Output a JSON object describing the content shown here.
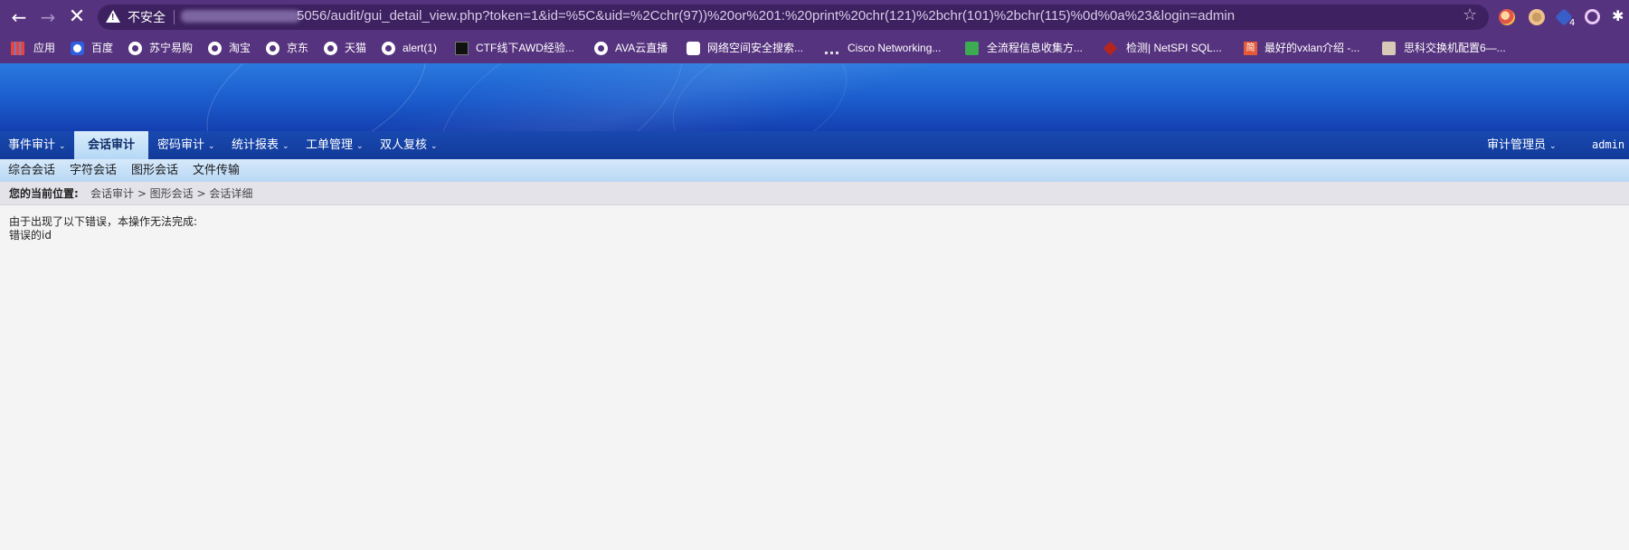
{
  "browser": {
    "back_icon": "arrow-left-icon",
    "forward_icon": "arrow-right-icon",
    "stop_icon": "close-icon",
    "security_label": "不安全",
    "url_visible": "5056/audit/gui_detail_view.php?token=1&id=%5C&uid=%2Cchr(97))%20or%201:%20print%20chr(121)%2bchr(101)%2bchr(115)%0d%0a%23&login=admin",
    "extension_badge": "4"
  },
  "bookmarks": [
    {
      "label": "应用",
      "icon": "apps-grid-icon"
    },
    {
      "label": "百度",
      "icon": "baidu-icon"
    },
    {
      "label": "苏宁易购",
      "icon": "globe-icon"
    },
    {
      "label": "淘宝",
      "icon": "globe-icon"
    },
    {
      "label": "京东",
      "icon": "globe-icon"
    },
    {
      "label": "天猫",
      "icon": "globe-icon"
    },
    {
      "label": "alert(1)",
      "icon": "globe-icon"
    },
    {
      "label": "CTF线下AWD经验...",
      "icon": "ctf-icon"
    },
    {
      "label": "AVA云直播",
      "icon": "globe-icon"
    },
    {
      "label": "网络空间安全搜索...",
      "icon": "fofa-icon"
    },
    {
      "label": "Cisco Networking...",
      "icon": "cisco-icon"
    },
    {
      "label": "全流程信息收集方...",
      "icon": "green-doc-icon"
    },
    {
      "label": "检测| NetSPI SQL...",
      "icon": "netspi-icon"
    },
    {
      "label": "最好的vxlan介绍 -...",
      "icon": "jianshu-icon"
    },
    {
      "label": "思科交换机配置6—...",
      "icon": "photo-icon"
    }
  ],
  "main_menu": [
    {
      "label": "事件审计"
    },
    {
      "label": "会话审计"
    },
    {
      "label": "密码审计"
    },
    {
      "label": "统计报表"
    },
    {
      "label": "工单管理"
    },
    {
      "label": "双人复核"
    }
  ],
  "user_menu": {
    "role": "审计管理员",
    "user": "admin"
  },
  "sub_menu": [
    {
      "label": "综合会话"
    },
    {
      "label": "字符会话"
    },
    {
      "label": "图形会话"
    },
    {
      "label": "文件传输"
    }
  ],
  "breadcrumb": {
    "label": "您的当前位置:",
    "trail": "会话审计 > 图形会话 > 会话详细"
  },
  "message": {
    "line1": "由于出现了以下错误，本操作无法完成:",
    "line2": "错误的id"
  }
}
